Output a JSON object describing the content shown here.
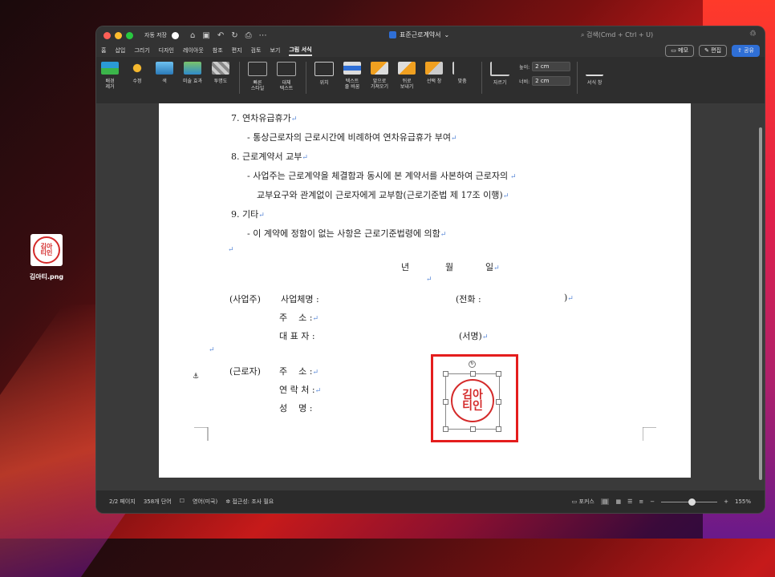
{
  "desktop": {
    "file_label": "김아티.png",
    "stamp_top": "김아",
    "stamp_bottom": "티인"
  },
  "window": {
    "autosave_label": "자동 저장",
    "doc_title": "표준근로계약서",
    "search_placeholder": "검색(Cmd + Ctrl + U)"
  },
  "tabs": [
    {
      "label": "홈"
    },
    {
      "label": "삽입"
    },
    {
      "label": "그리기"
    },
    {
      "label": "디자인"
    },
    {
      "label": "레이아웃"
    },
    {
      "label": "참조"
    },
    {
      "label": "편지"
    },
    {
      "label": "검토"
    },
    {
      "label": "보기"
    },
    {
      "label": "그림 서식"
    }
  ],
  "tab_actions": {
    "memo": "메모",
    "edit": "편집",
    "share": "공유"
  },
  "ribbon": {
    "items": [
      {
        "label": "배경\n제거"
      },
      {
        "label": "수정"
      },
      {
        "label": "색"
      },
      {
        "label": "미술 효과"
      },
      {
        "label": "투명도"
      },
      {
        "label": "빠른\n스타일"
      },
      {
        "label": "대체\n텍스트"
      },
      {
        "label": "위치"
      },
      {
        "label": "텍스트\n줄 바꿈"
      },
      {
        "label": "앞으로\n가져오기"
      },
      {
        "label": "뒤로\n보내기"
      },
      {
        "label": "선택 창"
      },
      {
        "label": "맞춤"
      },
      {
        "label": "자르기"
      },
      {
        "label": "서식 창"
      }
    ],
    "height_label": "높이:",
    "height_value": "2 cm",
    "width_label": "너비:",
    "width_value": "2 cm"
  },
  "document": {
    "lines": [
      "7. 연차유급휴가",
      "- 통상근로자의 근로시간에 비례하여 연차유급휴가 부여",
      "8. 근로계약서 교부",
      "- 사업주는 근로계약을 체결함과 동시에 본 계약서를 사본하여 근로자의",
      "교부요구와 관계없이 근로자에게 교부함(근로기준법 제 17조 이행)",
      "9. 기타",
      "- 이 계약에 정함이 없는 사항은 근로기준법령에 의함"
    ],
    "date_year": "년",
    "date_month": "월",
    "date_day": "일",
    "employer_label": "(사업주)",
    "business_name_label": "사업체명 :",
    "phone_label": "(전화 :",
    "phone_close": ")",
    "address_label": "주    소 :",
    "ceo_label": "대 표 자 :",
    "sign_label": "(서명)",
    "worker_label": "(근로자)",
    "worker_address_label": "주    소 :",
    "contact_label": "연 락 처 :",
    "name_label": "성    명 :"
  },
  "status": {
    "page": "2/2 페이지",
    "words": "358개 단어",
    "language": "영어(미국)",
    "accessibility": "접근성: 조사 필요",
    "focus": "포커스",
    "zoom": "155%"
  },
  "colors": {
    "stamp_red": "#d42a2a",
    "accent_blue": "#2f6fd6",
    "selection_red": "#e41d1d"
  }
}
